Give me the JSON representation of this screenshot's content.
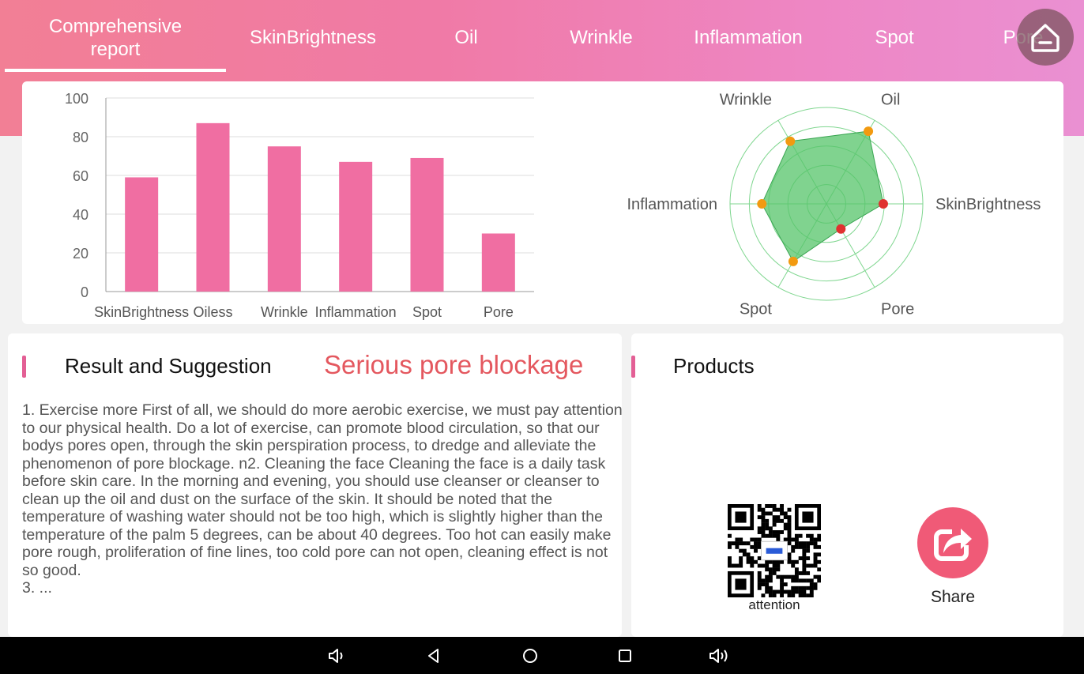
{
  "tabs": [
    {
      "label_line1": "Comprehensive",
      "label_line2": "report"
    },
    {
      "label": "SkinBrightness"
    },
    {
      "label": "Oil"
    },
    {
      "label": "Wrinkle"
    },
    {
      "label": "Inflammation"
    },
    {
      "label": "Spot"
    },
    {
      "label": "Pore"
    }
  ],
  "chart_data": [
    {
      "type": "bar",
      "categories": [
        "SkinBrightness",
        "Oiless",
        "Wrinkle",
        "Inflammation",
        "Spot",
        "Pore"
      ],
      "values": [
        59,
        87,
        75,
        67,
        69,
        30
      ],
      "ylim": [
        0,
        100
      ],
      "yticks": [
        "0",
        "20",
        "40",
        "60",
        "80",
        "100"
      ],
      "grid": true,
      "color": "#f06ea2"
    },
    {
      "type": "radar",
      "categories": [
        "SkinBrightness",
        "Oil",
        "Wrinkle",
        "Inflammation",
        "Spot",
        "Pore"
      ],
      "values": [
        59,
        87,
        75,
        67,
        69,
        30
      ],
      "range": [
        0,
        100
      ],
      "point_colors": [
        "#e0312f",
        "#f29a10",
        "#f29a10",
        "#f29a10",
        "#f29a10",
        "#e0312f"
      ],
      "fill_color": "#55c46a",
      "grid_color": "#7fd68f"
    }
  ],
  "result": {
    "title": "Result and Suggestion",
    "status": "Serious pore blockage",
    "text": "1. Exercise more First of all, we should do more aerobic exercise, we must pay attention to our physical health. Do a lot of exercise, can promote blood circulation, so that our bodys pores open, through the skin perspiration process, to dredge and alleviate the phenomenon of pore blockage.  n2. Cleaning the face Cleaning the face is a daily task before skin care. In the morning and evening, you should use cleanser or cleanser to clean up the oil and dust on the surface of the skin. It should be noted that the temperature of washing water should not be too high, which is slightly higher than the temperature of the palm 5 degrees, can be about 40 degrees. Too hot can easily make pore rough, proliferation of fine lines, too cold pore can not open, cleaning effect is not so good.",
    "text_cut": "3. ..."
  },
  "products": {
    "title": "Products",
    "qr_label": "attention",
    "share_label": "Share"
  },
  "colors": {
    "accent": "#e35f95",
    "status": "#e4585f",
    "bar": "#f06ea2",
    "share": "#f05a77"
  },
  "icons": {
    "home": "home-icon",
    "share": "share-icon",
    "nav": [
      "volume-down-icon",
      "back-icon",
      "home-circle-icon",
      "recents-icon",
      "volume-up-icon"
    ]
  }
}
